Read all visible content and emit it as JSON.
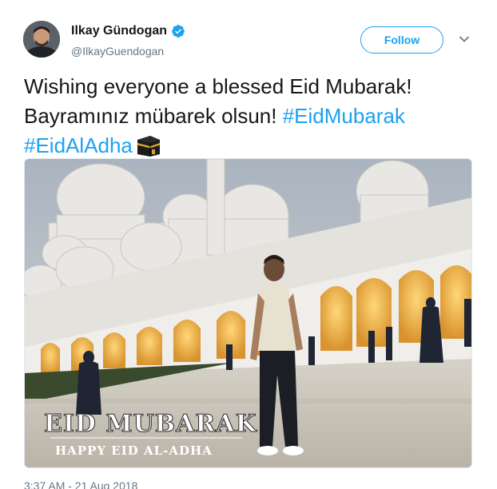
{
  "user": {
    "display_name": "Ilkay Gündogan",
    "handle": "@IlkayGuendogan",
    "verified_icon": "verified-badge-icon"
  },
  "header": {
    "follow_label": "Follow",
    "menu_icon": "chevron-down-icon"
  },
  "tweet": {
    "line1": "Wishing everyone a blessed Eid Mubarak!",
    "line2_text": "Bayramınız mübarek olsun! ",
    "hashtag1": "#EidMubarak",
    "hashtag2": "#EidAlAdha",
    "emoji_icon": "kaaba-icon"
  },
  "media": {
    "overlay_title": "EID MUBARAK",
    "overlay_subtitle": "HAPPY EID AL-ADHA"
  },
  "footer": {
    "timestamp": "3:37 AM - 21 Aug 2018"
  },
  "colors": {
    "accent": "#1da1f2",
    "text": "#14171a",
    "muted": "#657786"
  }
}
